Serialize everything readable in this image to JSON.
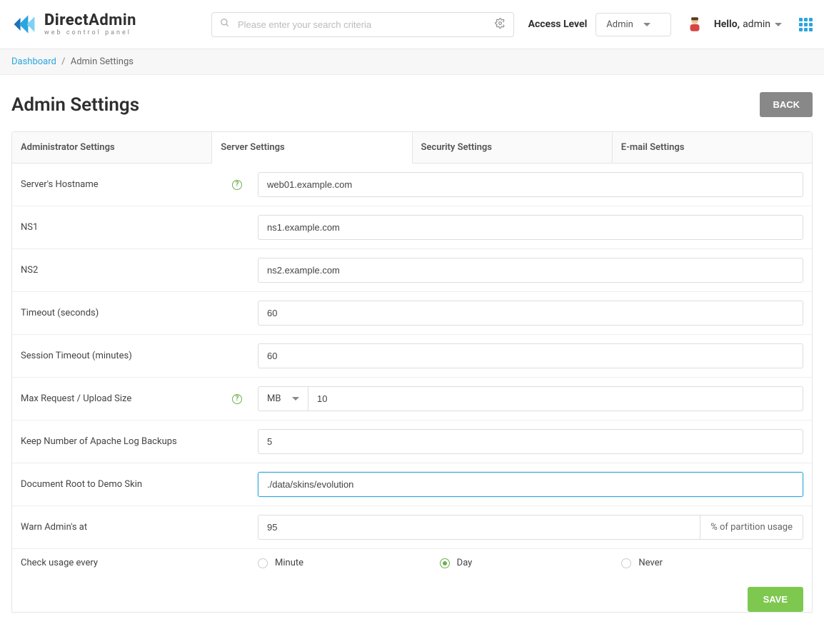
{
  "brand": {
    "name_strong": "Direct",
    "name_rest": "Admin",
    "tagline": "web control panel"
  },
  "search": {
    "placeholder": "Please enter your search criteria"
  },
  "access": {
    "label": "Access Level",
    "value": "Admin"
  },
  "user": {
    "greeting_prefix": "Hello,",
    "greeting_name": "admin"
  },
  "breadcrumb": {
    "root": "Dashboard",
    "current": "Admin Settings"
  },
  "page": {
    "title": "Admin Settings",
    "back": "BACK"
  },
  "tabs": {
    "admin": "Administrator Settings",
    "server": "Server Settings",
    "security": "Security Settings",
    "email": "E-mail Settings"
  },
  "labels": {
    "hostname": "Server's Hostname",
    "ns1": "NS1",
    "ns2": "NS2",
    "timeout": "Timeout (seconds)",
    "session_timeout": "Session Timeout (minutes)",
    "max_request": "Max Request / Upload Size",
    "apache_backups": "Keep Number of Apache Log Backups",
    "docroot": "Document Root to Demo Skin",
    "warn_admins": "Warn Admin's at",
    "warn_admins_suffix": "% of partition usage",
    "check_usage": "Check usage every"
  },
  "values": {
    "hostname": "web01.example.com",
    "ns1": "ns1.example.com",
    "ns2": "ns2.example.com",
    "timeout": "60",
    "session_timeout": "60",
    "unit": "MB",
    "max_request": "10",
    "apache_backups": "5",
    "docroot": "./data/skins/evolution",
    "warn_admins": "95"
  },
  "radio": {
    "minute": "Minute",
    "day": "Day",
    "never": "Never",
    "selected": "day"
  },
  "buttons": {
    "save": "SAVE"
  }
}
